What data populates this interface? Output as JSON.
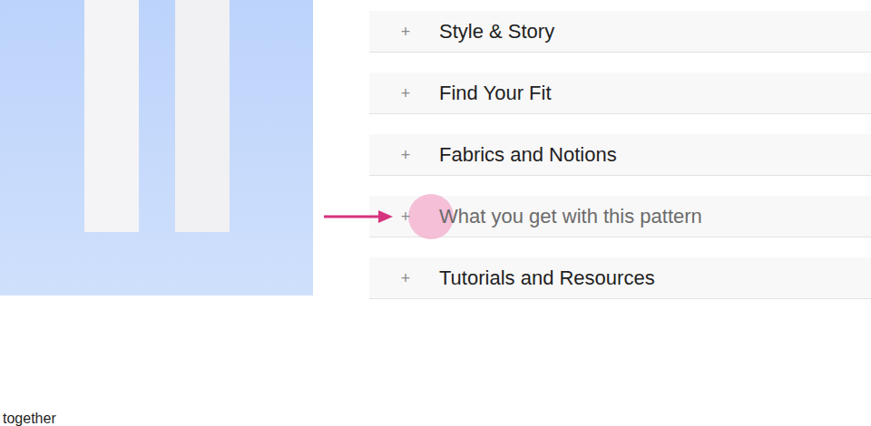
{
  "accordion": {
    "items": [
      {
        "icon": "+",
        "label": "Style & Story",
        "highlighted": false
      },
      {
        "icon": "+",
        "label": "Find Your Fit",
        "highlighted": false
      },
      {
        "icon": "+",
        "label": "Fabrics and Notions",
        "highlighted": false
      },
      {
        "icon": "+",
        "label": "What you get with this pattern",
        "highlighted": true
      },
      {
        "icon": "+",
        "label": "Tutorials and Resources",
        "highlighted": false
      }
    ]
  },
  "footer_text": "together"
}
